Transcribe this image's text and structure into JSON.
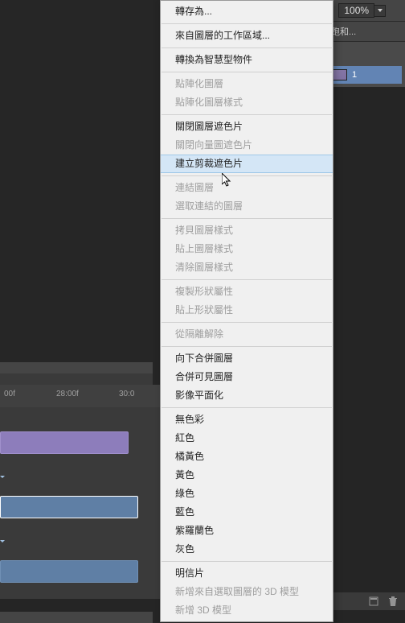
{
  "topbar": {
    "label_suffix": ": ",
    "zoom_value": "100%"
  },
  "panel": {
    "header": "跑和...",
    "layers": [
      {
        "name": "1",
        "selected": true
      }
    ]
  },
  "timeline": {
    "ticks": [
      {
        "pos": 5,
        "label": "00f"
      },
      {
        "pos": 70,
        "label": "28:00f"
      },
      {
        "pos": 148,
        "label": "30:0"
      }
    ]
  },
  "menu": {
    "items": [
      {
        "label": "轉存為...",
        "enabled": true
      },
      {
        "sep": true
      },
      {
        "label": "來自圖層的工作區域...",
        "enabled": true
      },
      {
        "sep": true
      },
      {
        "label": "轉換為智慧型物件",
        "enabled": true
      },
      {
        "sep": true
      },
      {
        "label": "點陣化圖層",
        "enabled": false
      },
      {
        "label": "點陣化圖層樣式",
        "enabled": false
      },
      {
        "sep": true
      },
      {
        "label": "關閉圖層遮色片",
        "enabled": true
      },
      {
        "label": "關閉向量圖遮色片",
        "enabled": false
      },
      {
        "label": "建立剪裁遮色片",
        "enabled": true,
        "highlighted": true
      },
      {
        "sep": true
      },
      {
        "label": "連結圖層",
        "enabled": false
      },
      {
        "label": "選取連結的圖層",
        "enabled": false
      },
      {
        "sep": true
      },
      {
        "label": "拷貝圖層樣式",
        "enabled": false
      },
      {
        "label": "貼上圖層樣式",
        "enabled": false
      },
      {
        "label": "清除圖層樣式",
        "enabled": false
      },
      {
        "sep": true
      },
      {
        "label": "複製形狀屬性",
        "enabled": false
      },
      {
        "label": "貼上形狀屬性",
        "enabled": false
      },
      {
        "sep": true
      },
      {
        "label": "從隔離解除",
        "enabled": false
      },
      {
        "sep": true
      },
      {
        "label": "向下合併圖層",
        "enabled": true
      },
      {
        "label": "合併可見圖層",
        "enabled": true
      },
      {
        "label": "影像平面化",
        "enabled": true
      },
      {
        "sep": true
      },
      {
        "label": "無色彩",
        "enabled": true
      },
      {
        "label": "紅色",
        "enabled": true
      },
      {
        "label": "橘黃色",
        "enabled": true
      },
      {
        "label": "黃色",
        "enabled": true
      },
      {
        "label": "綠色",
        "enabled": true
      },
      {
        "label": "藍色",
        "enabled": true
      },
      {
        "label": "紫羅蘭色",
        "enabled": true
      },
      {
        "label": "灰色",
        "enabled": true
      },
      {
        "sep": true
      },
      {
        "label": "明信片",
        "enabled": true
      },
      {
        "label": "新增來自選取圖層的 3D 模型",
        "enabled": false
      },
      {
        "label": "新增 3D 模型",
        "enabled": false
      }
    ]
  }
}
